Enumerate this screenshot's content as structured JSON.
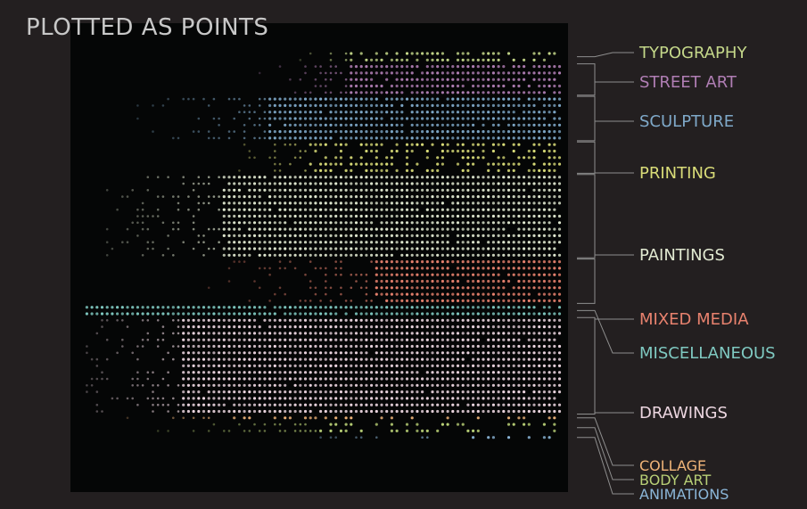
{
  "title": "PLOTTED AS POINTS",
  "chart_data": {
    "type": "scatter",
    "title": "PLOTTED AS POINTS",
    "xlabel": "",
    "ylabel": "",
    "grid": false,
    "legend_position": "right",
    "categories": [
      {
        "name": "TYPOGRAPHY",
        "color": "#c5d88a",
        "rows": 2,
        "full_from": 0.56,
        "sparse_from": 0.46,
        "density": 0.55
      },
      {
        "name": "STREET ART",
        "color": "#b07eb4",
        "rows": 5,
        "full_from": 0.56,
        "sparse_from": 0.37,
        "density": 0.9
      },
      {
        "name": "SCULPTURE",
        "color": "#7fa9c9",
        "rows": 7,
        "full_from": 0.4,
        "sparse_from": 0.1,
        "density": 0.95
      },
      {
        "name": "PRINTING",
        "color": "#d9dc78",
        "rows": 5,
        "full_from": 0.48,
        "sparse_from": 0.3,
        "density": 0.6
      },
      {
        "name": "PAINTINGS",
        "color": "#e2ead2",
        "rows": 13,
        "full_from": 0.3,
        "sparse_from": 0.05,
        "density": 0.98
      },
      {
        "name": "MIXED MEDIA",
        "color": "#e8826e",
        "rows": 7,
        "full_from": 0.62,
        "sparse_from": 0.24,
        "density": 0.95
      },
      {
        "name": "MISCELLANEOUS",
        "color": "#7fc9c1",
        "rows": 2,
        "full_from": 0.02,
        "sparse_from": 0.0,
        "density": 0.95
      },
      {
        "name": "DRAWINGS",
        "color": "#ecd6e0",
        "rows": 15,
        "full_from": 0.22,
        "sparse_from": 0.0,
        "density": 0.98
      },
      {
        "name": "COLLAGE",
        "color": "#f1b579",
        "rows": 1,
        "full_from": 0.3,
        "sparse_from": 0.1,
        "density": 0.4
      },
      {
        "name": "BODY ART",
        "color": "#b8cf76",
        "rows": 2,
        "full_from": 0.5,
        "sparse_from": 0.15,
        "density": 0.35
      },
      {
        "name": "ANIMATIONS",
        "color": "#8bb6d8",
        "rows": 1,
        "full_from": 0.75,
        "sparse_from": 0.4,
        "density": 0.25
      }
    ]
  }
}
